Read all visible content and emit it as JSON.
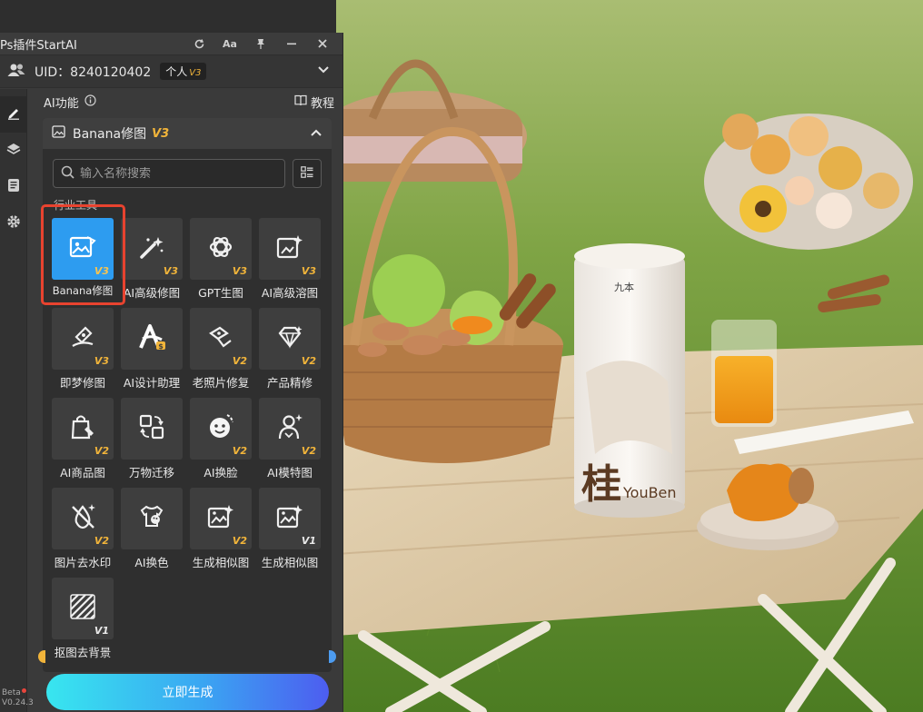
{
  "panel": {
    "title": "Ps插件StartAI",
    "uid_text": "UID：8240120402",
    "plan_badge": "个人",
    "plan_version": "V3"
  },
  "ai_section": {
    "title": "AI功能",
    "tutorial": "教程"
  },
  "category": {
    "title": "Banana修图",
    "version": "V3"
  },
  "search": {
    "placeholder": "输入名称搜索"
  },
  "section_label": "行业工具",
  "tools": [
    {
      "name": "Banana修图",
      "version": "V3",
      "icon": "banana-image-icon"
    },
    {
      "name": "AI高级修图",
      "version": "V3",
      "icon": "magic-wand-icon"
    },
    {
      "name": "GPT生图",
      "version": "V3",
      "icon": "gpt-knot-icon"
    },
    {
      "name": "AI高级溶图",
      "version": "V3",
      "icon": "sparkle-image-icon"
    },
    {
      "name": "即梦修图",
      "version": "V3",
      "icon": "dream-brush-icon"
    },
    {
      "name": "AI设计助理",
      "version": "",
      "icon": "design-assistant-icon"
    },
    {
      "name": "老照片修复",
      "version": "V2",
      "icon": "photo-repair-icon"
    },
    {
      "name": "产品精修",
      "version": "V2",
      "icon": "diamond-icon"
    },
    {
      "name": "AI商品图",
      "version": "V2",
      "icon": "shopping-bag-icon"
    },
    {
      "name": "万物迁移",
      "version": "",
      "icon": "transfer-icon"
    },
    {
      "name": "AI换脸",
      "version": "V2",
      "icon": "face-swap-icon"
    },
    {
      "name": "AI模特图",
      "version": "V2",
      "icon": "model-person-icon"
    },
    {
      "name": "图片去水印",
      "version": "V2",
      "icon": "remove-watermark-icon"
    },
    {
      "name": "AI换色",
      "version": "",
      "icon": "tshirt-palette-icon"
    },
    {
      "name": "生成相似图",
      "version": "V2",
      "icon": "similar-image-icon"
    },
    {
      "name": "生成相似图",
      "version": "V1",
      "icon": "similar-image-v1-icon"
    },
    {
      "name": "抠图去背景",
      "version": "V1",
      "icon": "cutout-stripes-icon"
    }
  ],
  "sidebar": {
    "items": [
      "edit-icon",
      "layers-icon",
      "notes-icon",
      "settings-icon"
    ],
    "beta_label": "Beta",
    "version_label": "V0.24.3"
  },
  "generate_button": "立即生成",
  "photo": {
    "can_text_top": "九本",
    "can_text_big": "桂",
    "can_text_brand": "YouBen"
  },
  "colors": {
    "accent_blue": "#2d9cf0",
    "version_gold": "#f1b43a",
    "highlight_red": "#e8432f"
  }
}
